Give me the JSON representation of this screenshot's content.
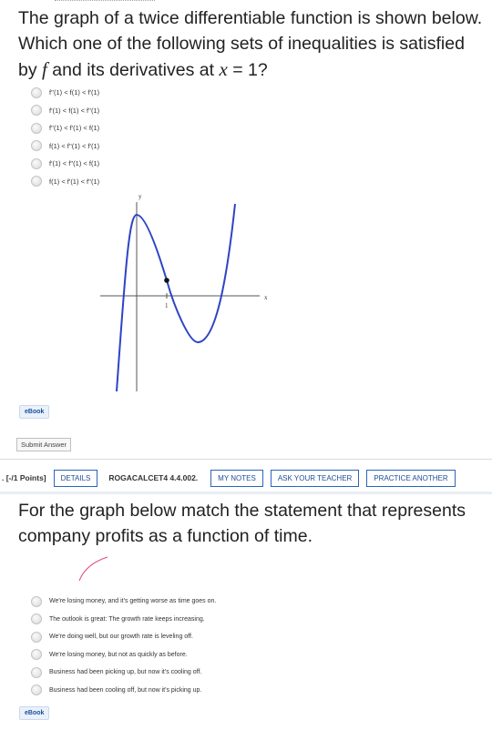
{
  "question1": {
    "text_before_f": "The graph of a twice differentiable function is shown below. Which one of the following sets of inequalities is satisfied by ",
    "f": "f",
    "text_after_f": " and its derivatives at ",
    "x": "x",
    "text_end": " = 1?",
    "options": [
      "f''(1) < f(1) < f'(1)",
      "f'(1) < f(1) < f''(1)",
      "f''(1) < f'(1) < f(1)",
      "f(1) < f''(1) < f'(1)",
      "f'(1) < f''(1) < f(1)",
      "f(1) < f'(1) < f''(1)"
    ],
    "graph": {
      "y_label": "y",
      "x_label": "x",
      "tick_label": "1"
    },
    "ebook_label": "eBook",
    "submit_label": "Submit Answer"
  },
  "header2": {
    "points": ". [-/1 Points]",
    "details": "DETAILS",
    "code": "ROGACALCET4 4.4.002.",
    "my_notes": "MY NOTES",
    "ask_teacher": "ASK YOUR TEACHER",
    "practice": "PRACTICE ANOTHER"
  },
  "question2": {
    "text": "For the graph below match the statement that represents company profits as a function of time.",
    "sketch_color": "#e0457b",
    "options": [
      "We're losing money, and it's getting worse as time goes on.",
      "The outlook is great: The growth rate keeps increasing.",
      "We're doing well, but our growth rate is leveling off.",
      "We're losing money, but not as quickly as before.",
      "Business had been picking up, but now it's cooling off.",
      "Business had been cooling off, but now it's picking up."
    ],
    "ebook_label": "eBook"
  },
  "colors": {
    "link_blue": "#2a66b8",
    "curve_blue": "#2d44c4"
  }
}
